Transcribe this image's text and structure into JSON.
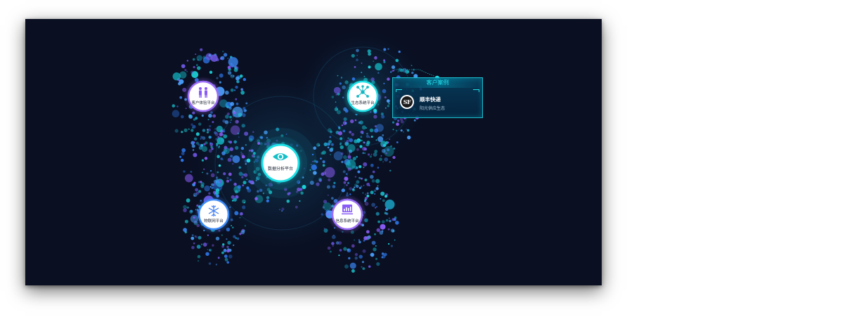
{
  "nodes": {
    "center": {
      "label": "数据分析平台",
      "icon": "eye-icon"
    },
    "top_left": {
      "label": "客户体验平台",
      "icon": "people-icon"
    },
    "top_right": {
      "label": "生态系统平台",
      "icon": "network-icon"
    },
    "bottom_left": {
      "label": "物联网平台",
      "icon": "snowflake-icon"
    },
    "bottom_right": {
      "label": "信息系统平台",
      "icon": "chart-window-icon"
    }
  },
  "case_card": {
    "title": "客户案例",
    "company": "顺丰快递",
    "description": "阳光供应生态",
    "logo_text": "SF"
  },
  "colors": {
    "background": "#0a0f22",
    "accent_cyan": "#1de0e6",
    "accent_purple": "#8a5cf6",
    "accent_blue": "#2f7df6"
  }
}
